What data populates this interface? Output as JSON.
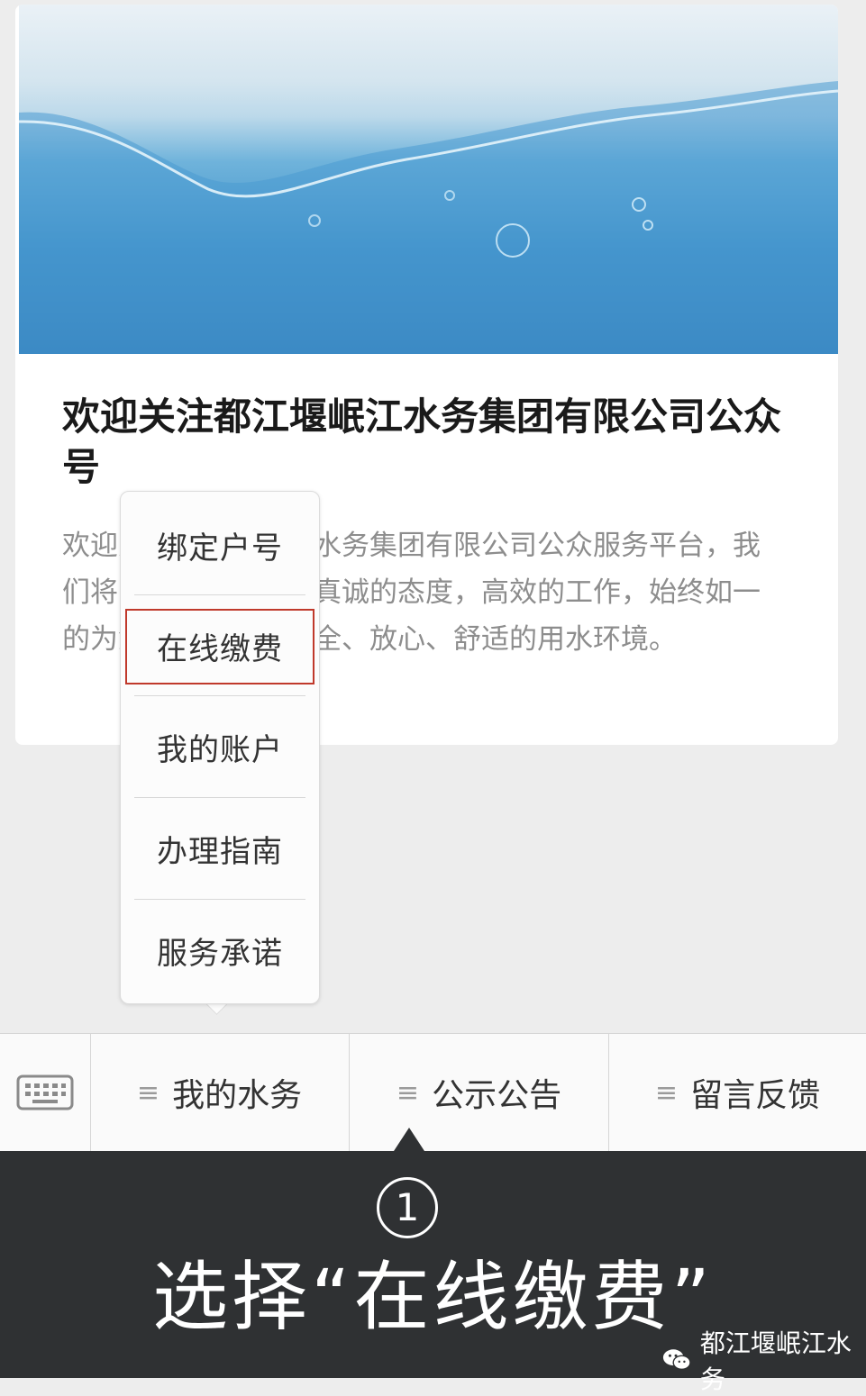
{
  "article": {
    "title": "欢迎关注都江堰岷江水务集团有限公司公众号",
    "description": "欢迎关注都江堰岷江水务集团有限公司公众服务平台，我们将以热忱的服务，真诚的态度，高效的工作，始终如一的为您和家人提供安全、放心、舒适的用水环境。"
  },
  "submenu": {
    "items": [
      {
        "label": "绑定户号"
      },
      {
        "label": "在线缴费"
      },
      {
        "label": "我的账户"
      },
      {
        "label": "办理指南"
      },
      {
        "label": "服务承诺"
      }
    ],
    "highlighted": "在线缴费"
  },
  "menubar": {
    "keyboard_icon": "keyboard-icon",
    "lines_glyph": "≡",
    "tabs": [
      {
        "label": "我的水务"
      },
      {
        "label": "公示公告"
      },
      {
        "label": "留言反馈"
      }
    ]
  },
  "caption": {
    "step": "1",
    "text": "选择“在线缴费”"
  },
  "watermark": {
    "text": "都江堰岷江水务"
  },
  "colors": {
    "highlight_border": "#c0392b",
    "caption_background": "#2f3133"
  }
}
